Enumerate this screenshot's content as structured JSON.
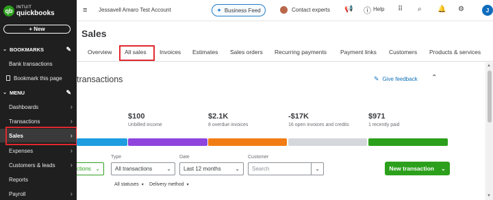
{
  "brand": {
    "logo_letter": "qb",
    "logo_line1": "INTUIT",
    "logo_line2": "quickbooks",
    "accent": "#2ca01c"
  },
  "sidebar": {
    "new_label": "+  New",
    "bookmarks_heading": "BOOKMARKS",
    "bookmark_items": [
      "Bank transactions",
      "Bookmark this page"
    ],
    "menu_heading": "MENU",
    "menu_items": [
      {
        "label": "Dashboards"
      },
      {
        "label": "Transactions"
      },
      {
        "label": "Sales"
      },
      {
        "label": "Expenses"
      },
      {
        "label": "Customers & leads"
      },
      {
        "label": "Reports"
      },
      {
        "label": "Payroll"
      }
    ]
  },
  "topbar": {
    "account_name": "Jessavell Amaro Test Account",
    "business_feed": "Business Feed",
    "contact_experts": "Contact experts",
    "help": "Help",
    "avatar_initial": "J"
  },
  "page": {
    "title": "Sales",
    "tabs": [
      "Overview",
      "All sales",
      "Invoices",
      "Estimates",
      "Sales orders",
      "Recurring payments",
      "Payment links",
      "Customers",
      "Products & services"
    ],
    "active_tab": "All sales",
    "section_title": "transactions",
    "give_feedback": "Give feedback"
  },
  "stats": [
    {
      "value": "$100",
      "label": "Unbilled income",
      "color": "#8e44dd"
    },
    {
      "value": "$2.1K",
      "label": "8 overdue invoices",
      "color": "#f27d14"
    },
    {
      "value": "-$17K",
      "label": "16 open invoices and credits",
      "color": "#d4d7dc"
    },
    {
      "value": "$971",
      "label": "1 recently paid",
      "color": "#2ca01c"
    }
  ],
  "first_bar_color": "#1e9de0",
  "filters": {
    "partial_select": "ctions",
    "type_label": "Type",
    "type_value": "All transactions",
    "date_label": "Date",
    "date_value": "Last 12 months",
    "customer_label": "Customer",
    "customer_placeholder": "Search",
    "new_transaction": "New transaction",
    "all_statuses": "All statuses",
    "delivery_method": "Delivery method"
  }
}
